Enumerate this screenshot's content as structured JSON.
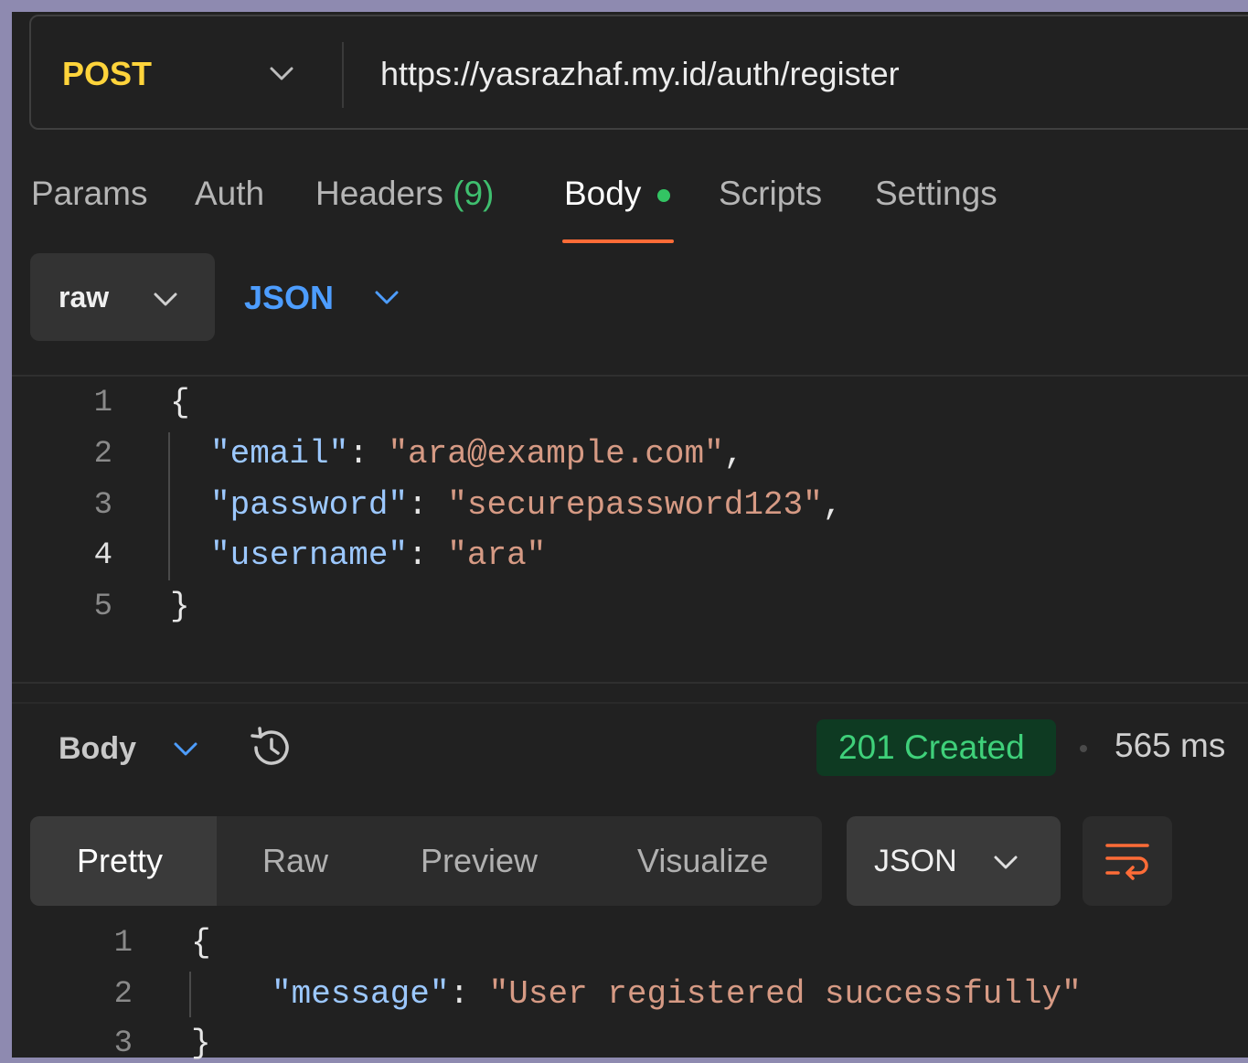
{
  "request": {
    "method": "POST",
    "url": "https://yasrazhaf.my.id/auth/register"
  },
  "tabs": {
    "params": "Params",
    "auth": "Auth",
    "headers": "Headers",
    "headers_count": "(9)",
    "body": "Body",
    "scripts": "Scripts",
    "settings": "Settings",
    "active": "Body"
  },
  "body_type": {
    "mode": "raw",
    "language": "JSON"
  },
  "request_body": {
    "line_numbers": [
      "1",
      "2",
      "3",
      "4",
      "5"
    ],
    "open_brace": "{",
    "close_brace": "}",
    "fields": [
      {
        "key": "\"email\"",
        "value": "\"ara@example.com\"",
        "comma": ","
      },
      {
        "key": "\"password\"",
        "value": "\"securepassword123\"",
        "comma": ","
      },
      {
        "key": "\"username\"",
        "value": "\"ara\"",
        "comma": ""
      }
    ],
    "colon": ":"
  },
  "response": {
    "section_label": "Body",
    "status": "201 Created",
    "time": "565 ms",
    "view_tabs": [
      "Pretty",
      "Raw",
      "Preview",
      "Visualize"
    ],
    "active_view": "Pretty",
    "format": "JSON",
    "line_numbers": [
      "1",
      "2",
      "3"
    ],
    "open_brace": "{",
    "close_brace": "}",
    "fields": [
      {
        "key": "\"message\"",
        "value": "\"User registered successfully\""
      }
    ],
    "colon": ":"
  },
  "colors": {
    "method": "#ffd43b",
    "accent": "#ff6c37",
    "success": "#3fd07a",
    "link": "#4d9dff"
  },
  "icons": {
    "method_dropdown": "chevron-down-icon",
    "history": "history-icon",
    "wrap": "wrap-lines-icon"
  }
}
